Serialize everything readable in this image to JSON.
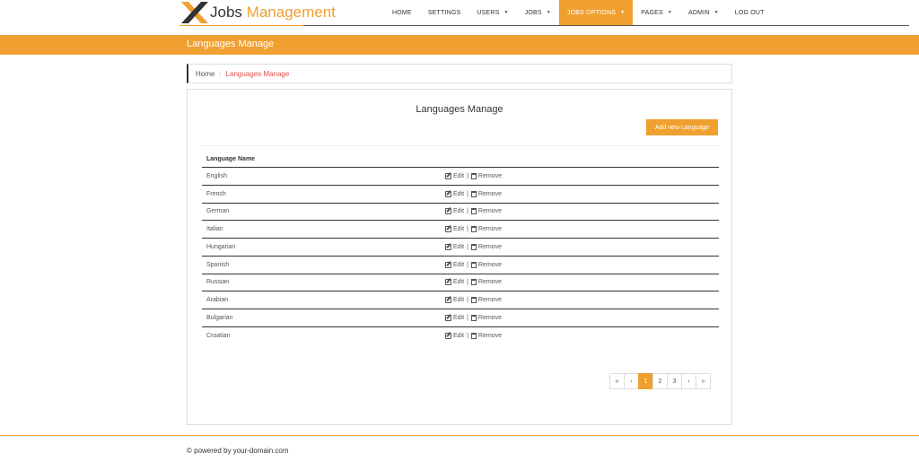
{
  "brand": {
    "part1": "Jobs",
    "part2": "Management",
    "accent": "#f0a030"
  },
  "nav": [
    {
      "label": "HOME",
      "caret": false,
      "active": false
    },
    {
      "label": "SETTINGS",
      "caret": false,
      "active": false
    },
    {
      "label": "USERS",
      "caret": true,
      "active": false
    },
    {
      "label": "JOBS",
      "caret": true,
      "active": false
    },
    {
      "label": "JOBS OPTIONS",
      "caret": true,
      "active": true
    },
    {
      "label": "PAGES",
      "caret": true,
      "active": false
    },
    {
      "label": "ADMIN",
      "caret": true,
      "active": false
    },
    {
      "label": "LOG OUT",
      "caret": false,
      "active": false
    }
  ],
  "band_title": "Languages Manage",
  "breadcrumb": {
    "home": "Home",
    "separator": "/",
    "current": "Languages Manage"
  },
  "panel": {
    "title": "Languages Manage",
    "add_button": "Add new Language",
    "column_header": "Language Name",
    "edit_label": "Edit",
    "action_sep": "|",
    "remove_label": "Remove",
    "rows": [
      "English",
      "French",
      "German",
      "Italian",
      "Hungarian",
      "Spanish",
      "Russian",
      "Arabian",
      "Bulgarian",
      "Croatian"
    ]
  },
  "pagination": {
    "first": "«",
    "prev": "‹",
    "pages": [
      "1",
      "2",
      "3"
    ],
    "current": "1",
    "next": "›",
    "last": "»"
  },
  "footer": "© powered by your-domain.com"
}
